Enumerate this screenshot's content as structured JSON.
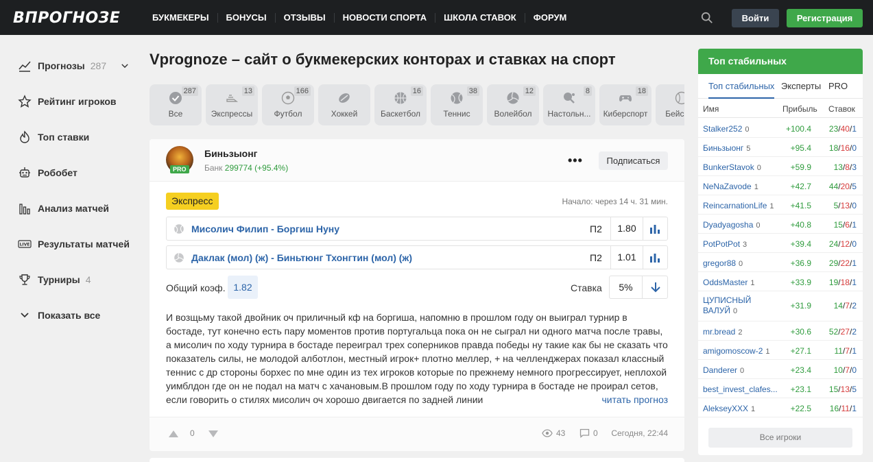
{
  "header": {
    "logo": "ВПРОГНОЗЕ",
    "nav": [
      "БУКМЕКЕРЫ",
      "БОНУСЫ",
      "ОТЗЫВЫ",
      "НОВОСТИ СПОРТА",
      "ШКОЛА СТАВОК",
      "ФОРУМ"
    ],
    "login_label": "Войти",
    "register_label": "Регистрация"
  },
  "sidebar": {
    "items": [
      {
        "label": "Прогнозы",
        "count": "287",
        "icon": "chart-line-icon"
      },
      {
        "label": "Рейтинг игроков",
        "icon": "star-icon"
      },
      {
        "label": "Топ ставки",
        "icon": "flame-icon"
      },
      {
        "label": "Робобет",
        "icon": "robot-icon"
      },
      {
        "label": "Анализ матчей",
        "icon": "bar-chart-icon"
      },
      {
        "label": "Результаты матчей",
        "icon": "live-icon"
      },
      {
        "label": "Турниры",
        "count": "4",
        "icon": "trophy-icon"
      },
      {
        "label": "Показать все",
        "icon": "chevron-down-icon"
      }
    ]
  },
  "main": {
    "title": "Vprognoze – сайт о букмекерских конторах и ставках на спорт",
    "sports": [
      {
        "label": "Все",
        "count": "287"
      },
      {
        "label": "Экспрессы",
        "count": "13"
      },
      {
        "label": "Футбол",
        "count": "166"
      },
      {
        "label": "Хоккей",
        "count": ""
      },
      {
        "label": "Баскетбол",
        "count": "16"
      },
      {
        "label": "Теннис",
        "count": "38"
      },
      {
        "label": "Волейбол",
        "count": "12"
      },
      {
        "label": "Настольн...",
        "count": "8"
      },
      {
        "label": "Киберспорт",
        "count": "18"
      },
      {
        "label": "Бейсбол",
        "count": ""
      }
    ],
    "card": {
      "user_name": "Биньзыонг",
      "pro": "PRO",
      "bank_label": "Банк",
      "bank_value": "299774",
      "bank_change": "(+95.4%)",
      "subscribe_label": "Подписаться",
      "type": "Экспресс",
      "start": "Начало: через 14 ч. 31 мин.",
      "bets": [
        {
          "title": "Мисолич Филип - Боргиш Нуну",
          "outcome": "П2",
          "coef": "1.80"
        },
        {
          "title": "Даклак (мол) (ж) - Биньтюнг Тхонгтин (мол) (ж)",
          "outcome": "П2",
          "coef": "1.01"
        }
      ],
      "total_label": "Общий коэф.",
      "total_value": "1.82",
      "stake_label": "Ставка",
      "stake_value": "5%",
      "text": "И возщьму такой двойник оч приличный кф на боргиша, напомню в прошлом году он выиграл турнир в бостаде, тут конечно есть пару моментов против португальца пока он не сыграл ни одного матча после травы, а мисолич по ходу турнира в бостаде переиграл трех соперников правда победы ну такие как бы не сказать что показатель силы, не молодой алботлон, местный игрок+ плотно меллер, + на челленджерах показал классный теннис с др стороны борхес по мне один из тех игроков которые по прежнему немного прогрессирует, неплохой уимблдон где он не подал на матч с хачановым.В прошлом году по ходу турнира в бостаде не проирал сетов, если говорить о стилях мисолич оч хорошо двигается по задней линии",
      "read_more": "читать прогноз",
      "votes": "0",
      "views": "43",
      "comments": "0",
      "date": "Сегодня, 22:44"
    }
  },
  "right_panel": {
    "title": "Топ стабильных",
    "tabs": [
      "Топ стабильных",
      "Эксперты",
      "PRO"
    ],
    "columns": [
      "Имя",
      "Прибыль",
      "Ставок"
    ],
    "rows": [
      {
        "name": "Stalker252",
        "level": "0",
        "profit": "+100.4",
        "w": "23",
        "l": "40",
        "d": "1"
      },
      {
        "name": "Биньзыонг",
        "level": "5",
        "profit": "+95.4",
        "w": "18",
        "l": "16",
        "d": "0"
      },
      {
        "name": "BunkerStavok",
        "level": "0",
        "profit": "+59.9",
        "w": "13",
        "l": "8",
        "d": "3"
      },
      {
        "name": "NeNaZavode",
        "level": "1",
        "profit": "+42.7",
        "w": "44",
        "l": "20",
        "d": "5"
      },
      {
        "name": "ReincarnationLife",
        "level": "1",
        "profit": "+41.5",
        "w": "5",
        "l": "13",
        "d": "0"
      },
      {
        "name": "Dyadyagosha",
        "level": "0",
        "profit": "+40.8",
        "w": "15",
        "l": "6",
        "d": "1"
      },
      {
        "name": "PotPotPot",
        "level": "3",
        "profit": "+39.4",
        "w": "24",
        "l": "12",
        "d": "0"
      },
      {
        "name": "gregor88",
        "level": "0",
        "profit": "+36.9",
        "w": "29",
        "l": "22",
        "d": "1"
      },
      {
        "name": "OddsMaster",
        "level": "1",
        "profit": "+33.9",
        "w": "19",
        "l": "18",
        "d": "1"
      },
      {
        "name": "ЦУПИСНЫЙ ВАЛУЙ",
        "level": "0",
        "profit": "+31.9",
        "w": "14",
        "l": "7",
        "d": "2"
      },
      {
        "name": "mr.bread",
        "level": "2",
        "profit": "+30.6",
        "w": "52",
        "l": "27",
        "d": "2"
      },
      {
        "name": "amigomoscow-2",
        "level": "1",
        "profit": "+27.1",
        "w": "11",
        "l": "7",
        "d": "1"
      },
      {
        "name": "Danderer",
        "level": "0",
        "profit": "+23.4",
        "w": "10",
        "l": "7",
        "d": "0"
      },
      {
        "name": "best_invest_clafes...",
        "level": "",
        "profit": "+23.1",
        "w": "15",
        "l": "13",
        "d": "5"
      },
      {
        "name": "AlekseyXXX",
        "level": "1",
        "profit": "+22.5",
        "w": "16",
        "l": "11",
        "d": "1"
      }
    ],
    "all_label": "Все игроки"
  },
  "colors": {
    "brand_green": "#3fa84a",
    "link_blue": "#2c64a8",
    "loss_red": "#d63a3a",
    "express_yellow": "#f5cf20",
    "header_dark": "#1d1f21"
  }
}
